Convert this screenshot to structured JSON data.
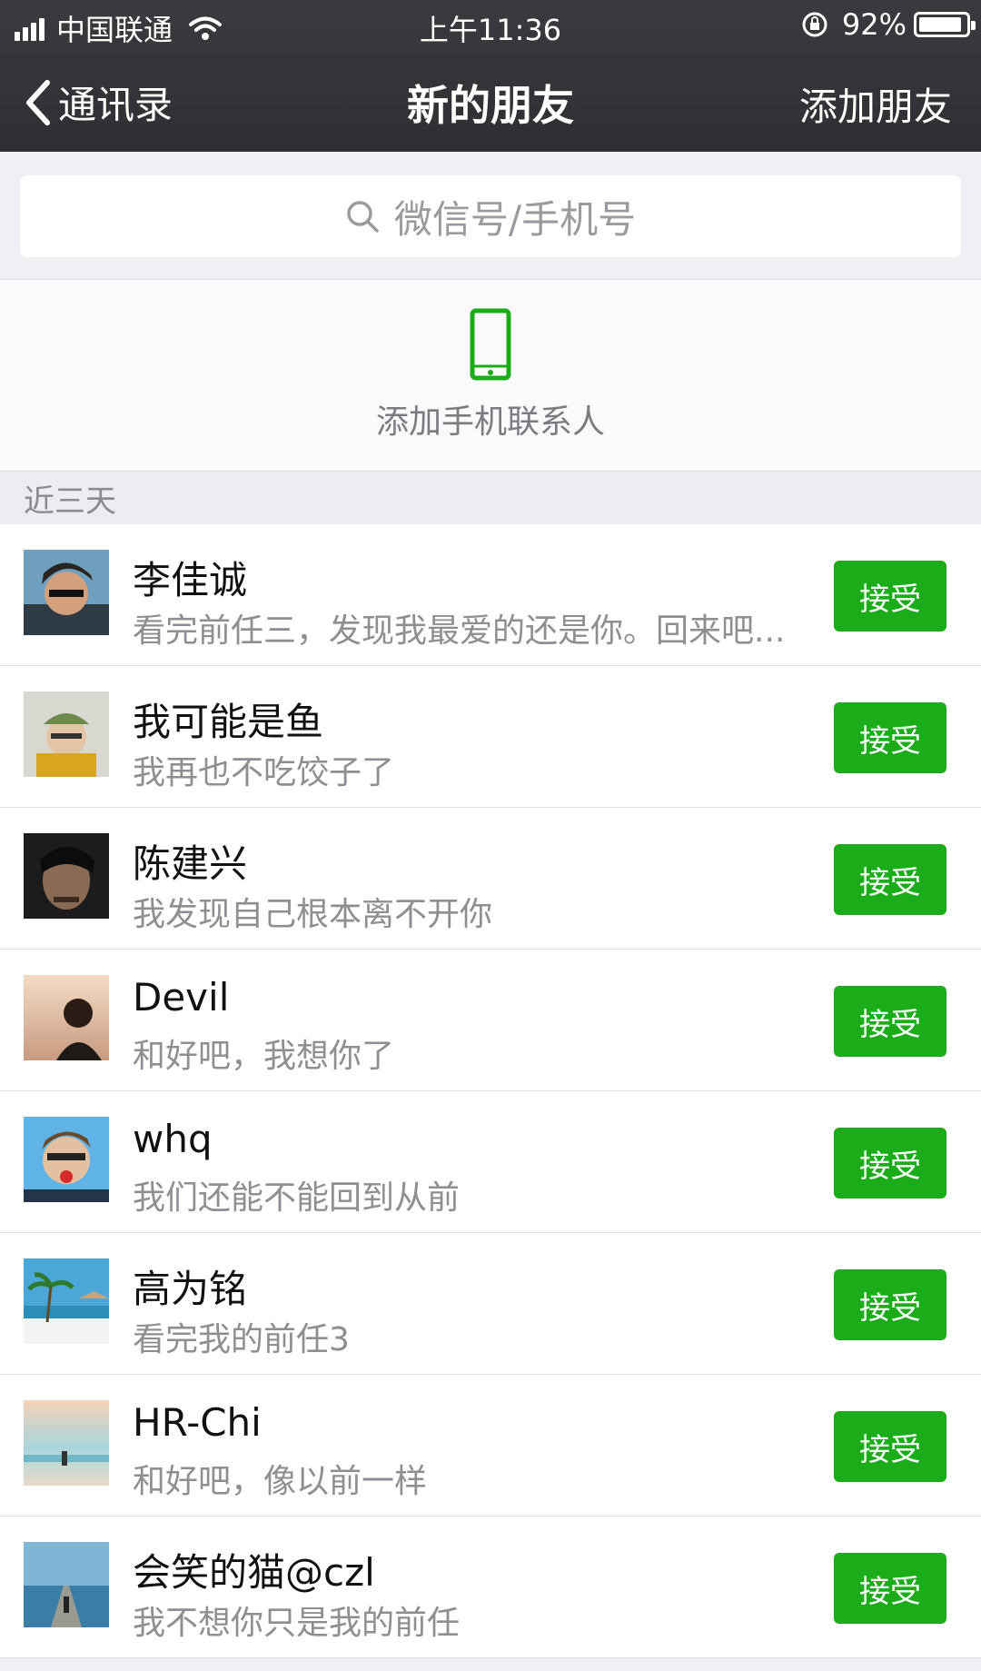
{
  "status_bar": {
    "carrier": "中国联通",
    "time": "上午11:36",
    "battery": "92%",
    "battery_level": 0.92
  },
  "nav": {
    "back_label": "通讯录",
    "title": "新的朋友",
    "right_action": "添加朋友"
  },
  "search": {
    "placeholder": "微信号/手机号"
  },
  "add_contacts": {
    "label": "添加手机联系人",
    "icon": "phone-icon",
    "icon_color": "#1aad19"
  },
  "section": {
    "title": "近三天"
  },
  "accent_color": "#1aad19",
  "requests": [
    {
      "name": "李佳诚",
      "message": "看完前任三，发现我最爱的还是你。回来吧...",
      "button": "接受"
    },
    {
      "name": "我可能是鱼",
      "message": "我再也不吃饺子了",
      "button": "接受"
    },
    {
      "name": "陈建兴",
      "message": "我发现自己根本离不开你",
      "button": "接受"
    },
    {
      "name": "Devil",
      "message": "和好吧，我想你了",
      "button": "接受"
    },
    {
      "name": "whq",
      "message": "我们还能不能回到从前",
      "button": "接受"
    },
    {
      "name": "高为铭",
      "message": "看完我的前任3",
      "button": "接受"
    },
    {
      "name": "HR-Chi",
      "message": "和好吧，像以前一样",
      "button": "接受"
    },
    {
      "name": "会笑的猫@czl",
      "message": "我不想你只是我的前任",
      "button": "接受"
    }
  ]
}
